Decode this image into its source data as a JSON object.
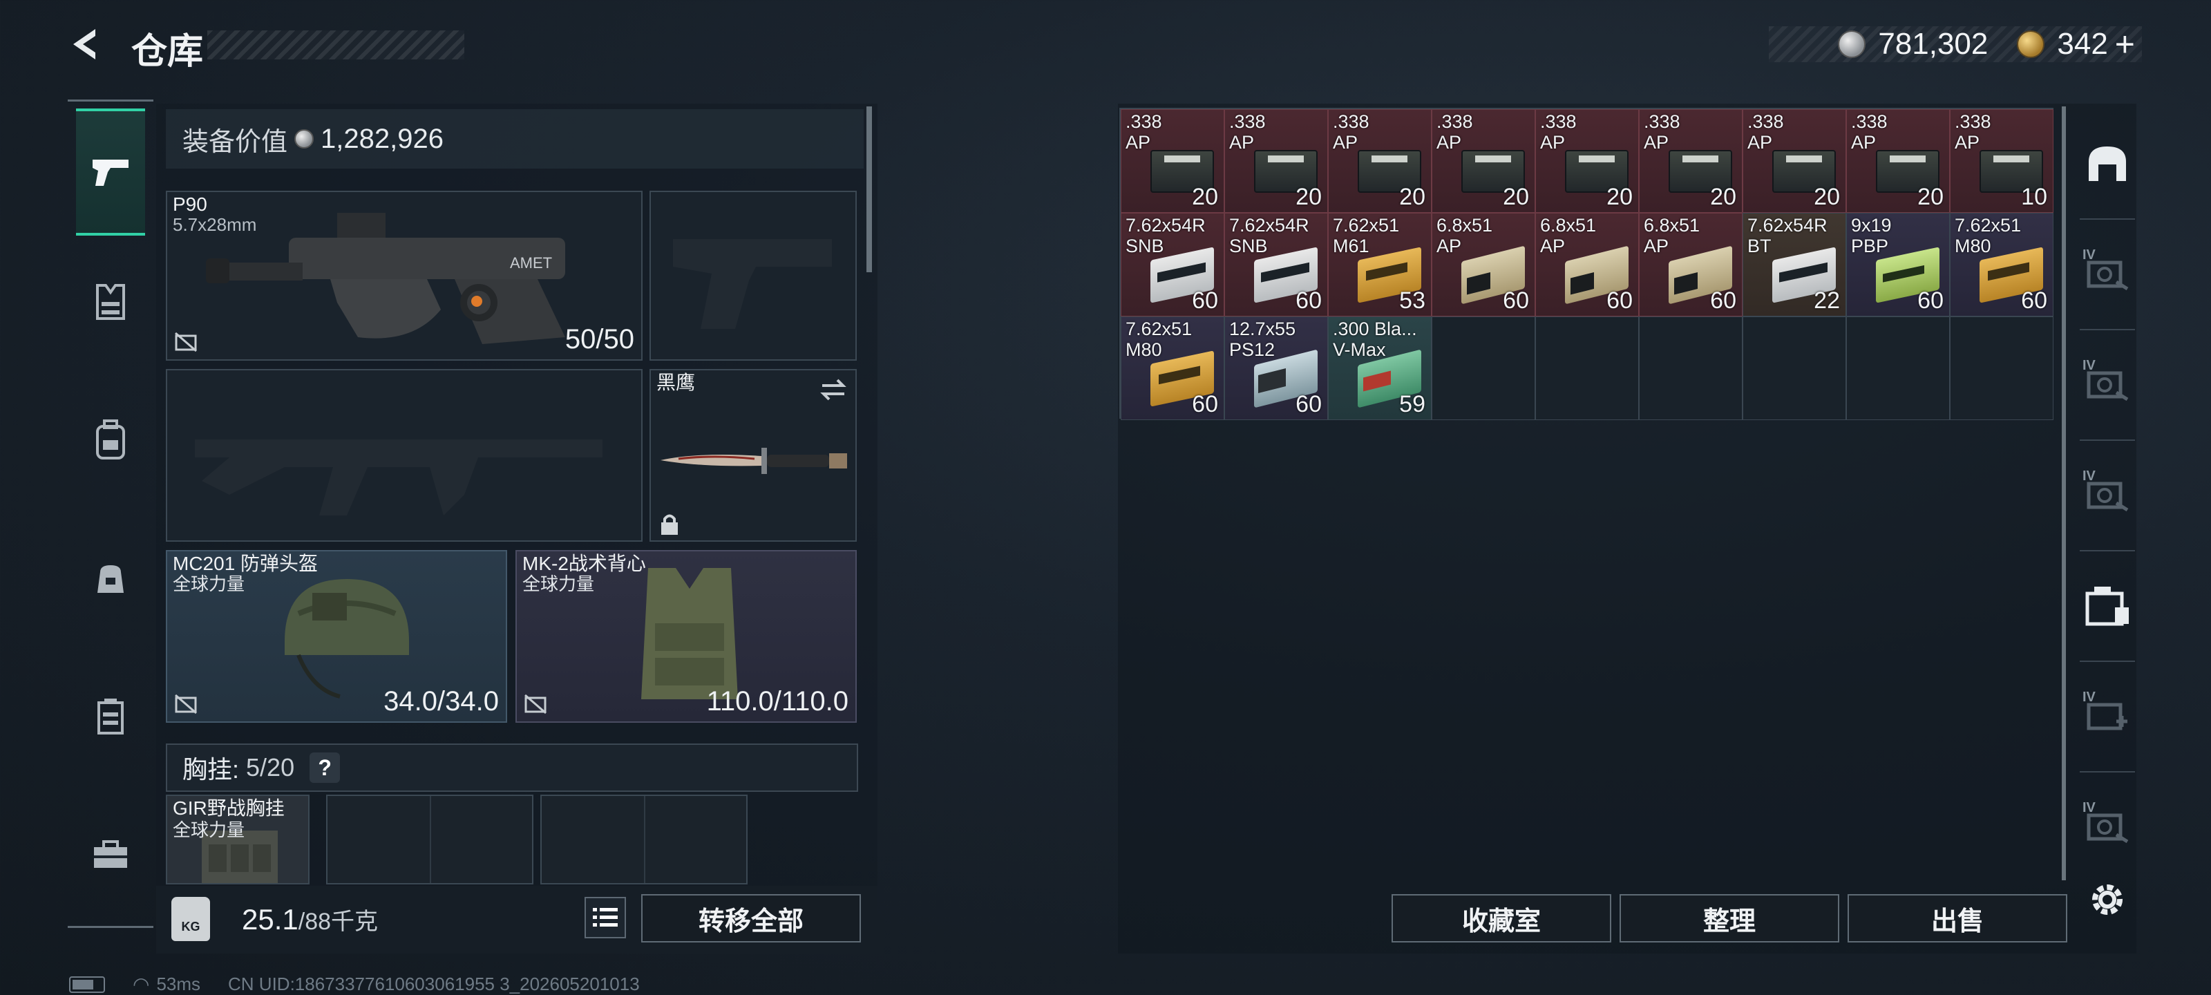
{
  "header": {
    "title": "仓库",
    "silver_amount": "781,302",
    "gold_amount": "342",
    "gold_plus": "+"
  },
  "left_nav": {
    "items": [
      {
        "name": "weapons",
        "icon": "pistol-icon",
        "active": true
      },
      {
        "name": "armor",
        "icon": "vest-icon",
        "active": false
      },
      {
        "name": "backpack-loadout",
        "icon": "backpack-icon",
        "active": false
      },
      {
        "name": "bag",
        "icon": "bag-icon",
        "active": false
      },
      {
        "name": "chest-rig",
        "icon": "rig-icon",
        "active": false
      },
      {
        "name": "toolbox",
        "icon": "toolbox-icon",
        "active": false
      }
    ]
  },
  "equipment": {
    "value_label": "装备价值",
    "value": "1,282,926",
    "primary_weapon": {
      "name": "P90",
      "caliber": "5.7x28mm",
      "ammo": "50/50"
    },
    "melee": {
      "name": "黑鹰"
    },
    "helmet": {
      "name": "MC201 防弹头盔",
      "sub": "全球力量",
      "durability": "34.0/34.0"
    },
    "vest": {
      "name": "MK-2战术背心",
      "sub": "全球力量",
      "durability": "110.0/110.0"
    },
    "chest_rig": {
      "label": "胸挂:",
      "count_current": "5",
      "count_max": "/20",
      "help": "?"
    },
    "rig_item": {
      "name": "GIR野战胸挂",
      "sub": "全球力量"
    }
  },
  "footer_left": {
    "weight_label": "KG",
    "weight_current": "25.1",
    "weight_max": "/88千克",
    "transfer_all": "转移全部"
  },
  "stash_grid": [
    {
      "name": ".338\nAP",
      "count": "20",
      "color": "red",
      "box": "can"
    },
    {
      "name": ".338\nAP",
      "count": "20",
      "color": "red",
      "box": "can"
    },
    {
      "name": ".338\nAP",
      "count": "20",
      "color": "red",
      "box": "can"
    },
    {
      "name": ".338\nAP",
      "count": "20",
      "color": "red",
      "box": "can"
    },
    {
      "name": ".338\nAP",
      "count": "20",
      "color": "red",
      "box": "can"
    },
    {
      "name": ".338\nAP",
      "count": "20",
      "color": "red",
      "box": "can"
    },
    {
      "name": ".338\nAP",
      "count": "20",
      "color": "red",
      "box": "can"
    },
    {
      "name": ".338\nAP",
      "count": "20",
      "color": "red",
      "box": "can"
    },
    {
      "name": ".338\nAP",
      "count": "10",
      "color": "red",
      "box": "can"
    },
    {
      "name": "7.62x54R\nSNB",
      "count": "60",
      "color": "red",
      "box": "white"
    },
    {
      "name": "7.62x54R\nSNB",
      "count": "60",
      "color": "red",
      "box": "white"
    },
    {
      "name": "7.62x51\nM61",
      "count": "53",
      "color": "red",
      "box": "gold"
    },
    {
      "name": "6.8x51\nAP",
      "count": "60",
      "color": "red",
      "box": "tan"
    },
    {
      "name": "6.8x51\nAP",
      "count": "60",
      "color": "red",
      "box": "tan"
    },
    {
      "name": "6.8x51\nAP",
      "count": "60",
      "color": "red",
      "box": "tan"
    },
    {
      "name": "7.62x54R\nBT",
      "count": "22",
      "color": "brown",
      "box": "white"
    },
    {
      "name": "9x19\nPBP",
      "count": "60",
      "color": "purple",
      "box": "lime"
    },
    {
      "name": "7.62x51\nM80",
      "count": "60",
      "color": "purple",
      "box": "gold"
    },
    {
      "name": "7.62x51\nM80",
      "count": "60",
      "color": "purple",
      "box": "gold"
    },
    {
      "name": "12.7x55\nPS12",
      "count": "60",
      "color": "purple",
      "box": "steel"
    },
    {
      "name": ".300 Bla...\nV-Max",
      "count": "59",
      "color": "teal",
      "box": "green"
    },
    {
      "name": "",
      "count": "",
      "color": "empty",
      "box": ""
    },
    {
      "name": "",
      "count": "",
      "color": "empty",
      "box": ""
    },
    {
      "name": "",
      "count": "",
      "color": "empty",
      "box": ""
    },
    {
      "name": "",
      "count": "",
      "color": "empty",
      "box": ""
    },
    {
      "name": "",
      "count": "",
      "color": "empty",
      "box": ""
    },
    {
      "name": "",
      "count": "",
      "color": "empty",
      "box": ""
    }
  ],
  "footer_right": {
    "collection": "收藏室",
    "sort": "整理",
    "sell": "出售"
  },
  "side_tabs": [
    {
      "icon": "safehouse-icon",
      "label": ""
    },
    {
      "icon": "stash-iv-icon",
      "label": "IV"
    },
    {
      "icon": "stash-iv-icon",
      "label": "IV"
    },
    {
      "icon": "stash-iv-icon",
      "label": "IV"
    },
    {
      "icon": "container-icon",
      "label": ""
    },
    {
      "icon": "medical-iv-icon",
      "label": "IV"
    },
    {
      "icon": "stash-iv-icon",
      "label": "IV"
    }
  ],
  "status": {
    "ping": "53ms",
    "uid": "CN UID:18673377610603061955 3_202605201013"
  }
}
